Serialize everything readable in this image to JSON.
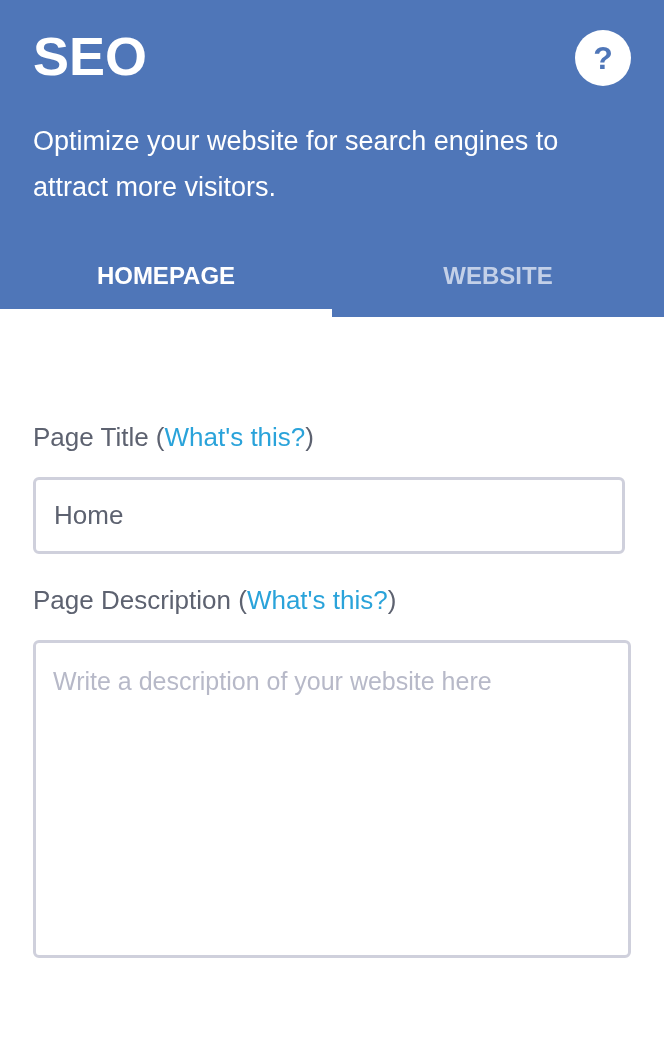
{
  "header": {
    "title": "SEO",
    "help": "?",
    "description": "Optimize your website for search engines to attract more visitors."
  },
  "tabs": [
    {
      "label": "HOMEPAGE",
      "selected": true
    },
    {
      "label": "WEBSITE",
      "selected": false
    }
  ],
  "fields": [
    {
      "kind": "input",
      "label_before": "Page Title (",
      "link": "What's this?",
      "label_after": ")",
      "value": "Home"
    },
    {
      "kind": "textarea",
      "label_before": "Page Description (",
      "link": "What's this?",
      "label_after": ")",
      "placeholder": "Write a description of your website here"
    }
  ]
}
